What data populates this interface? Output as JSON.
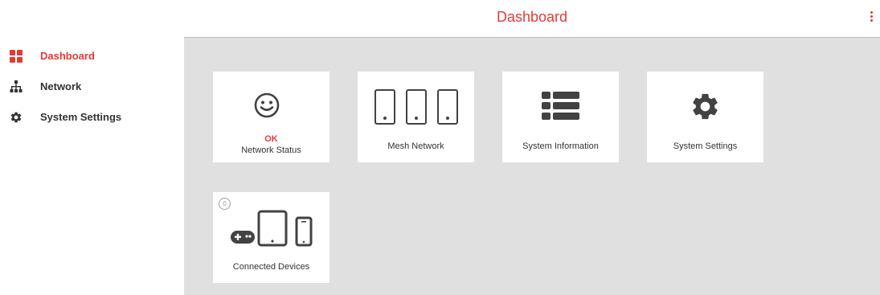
{
  "header": {
    "title": "Dashboard"
  },
  "sidebar": {
    "items": [
      {
        "label": "Dashboard",
        "icon": "dashboard-grid-icon",
        "active": true
      },
      {
        "label": "Network",
        "icon": "network-tree-icon",
        "active": false
      },
      {
        "label": "System Settings",
        "icon": "gear-icon",
        "active": false
      }
    ]
  },
  "tiles": {
    "network_status": {
      "status": "OK",
      "label": "Network Status",
      "icon": "smiley-icon"
    },
    "mesh_network": {
      "label": "Mesh Network",
      "icon": "mesh-nodes-icon"
    },
    "system_information": {
      "label": "System Information",
      "icon": "list-icon"
    },
    "system_settings": {
      "label": "System Settings",
      "icon": "gear-icon"
    },
    "connected_devices": {
      "label": "Connected Devices",
      "count": "0",
      "icon": "devices-icon"
    }
  },
  "colors": {
    "accent": "#e53935",
    "icon": "#424242",
    "content_bg": "#e0e0e0"
  }
}
